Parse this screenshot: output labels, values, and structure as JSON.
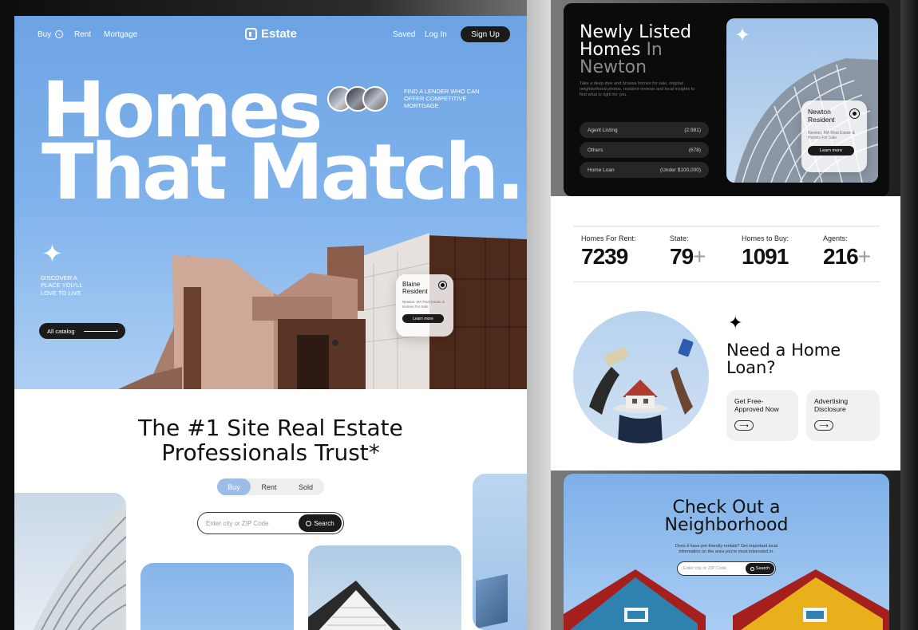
{
  "nav": {
    "buy": "Buy",
    "rent": "Rent",
    "mortgage": "Mortgage",
    "brand": "Estate",
    "saved": "Saved",
    "login": "Log In",
    "signup": "Sign Up"
  },
  "hero": {
    "title_line1": "Homes",
    "title_line2": "That Match.",
    "lender_text": "FIND A LENDER WHO CAN OFFER COMPETITIVE MORTGAGE",
    "discover_text": "DISCOVER A PLACE YOU'LL LOVE TO LIVE",
    "catalog_button": "All catalog",
    "card_title": "Blaine Resident",
    "card_sub": "Newton, MA Real Estate & Homes For Sale",
    "card_button": "Learn more"
  },
  "trust": {
    "title_line1": "The #1 Site Real Estate",
    "title_line2": "Professionals Trust*",
    "tabs": [
      "Buy",
      "Rent",
      "Sold"
    ],
    "search_placeholder": "Enter city or ZIP Code",
    "search_button": "Search"
  },
  "newly": {
    "title_line1": "Newly Listed",
    "title_line2_a": "Homes",
    "title_line2_b": "In",
    "title_line3": "Newton",
    "description": "Take a deep dive and browse homes for sale, original neighborhood photos, resident reviews and local insights to find what is right for you.",
    "rows": [
      {
        "label": "Agent Listing",
        "value": "(2.981)"
      },
      {
        "label": "Others",
        "value": "(678)"
      },
      {
        "label": "Home Loan",
        "value": "(Under $100,000)"
      }
    ],
    "card_title": "Newton Resident",
    "card_sub": "Newton, MA Real Estate & Homes For Sale",
    "card_button": "Learn more"
  },
  "stats": [
    {
      "label": "Homes For Rent:",
      "value": "7239",
      "plus": ""
    },
    {
      "label": "State:",
      "value": "79",
      "plus": "+"
    },
    {
      "label": "Homes to Buy:",
      "value": "1091",
      "plus": ""
    },
    {
      "label": "Agents:",
      "value": "216",
      "plus": "+"
    }
  ],
  "loan": {
    "title_line1": "Need a Home",
    "title_line2": "Loan?",
    "card1": "Get Free-Approved Now",
    "card2": "Advertising Disclosure"
  },
  "hood": {
    "title_line1": "Check Out a",
    "title_line2": "Neighborhood",
    "description": "Does it have pet-friendly rentals? Get important local information on the area you're most interested in.",
    "search_placeholder": "Enter city or ZIP Code",
    "search_button": "Search"
  },
  "colors": {
    "sky": "#7fb1ea",
    "dark": "#1b1b1b",
    "accent_blue": "#9dbde6"
  }
}
